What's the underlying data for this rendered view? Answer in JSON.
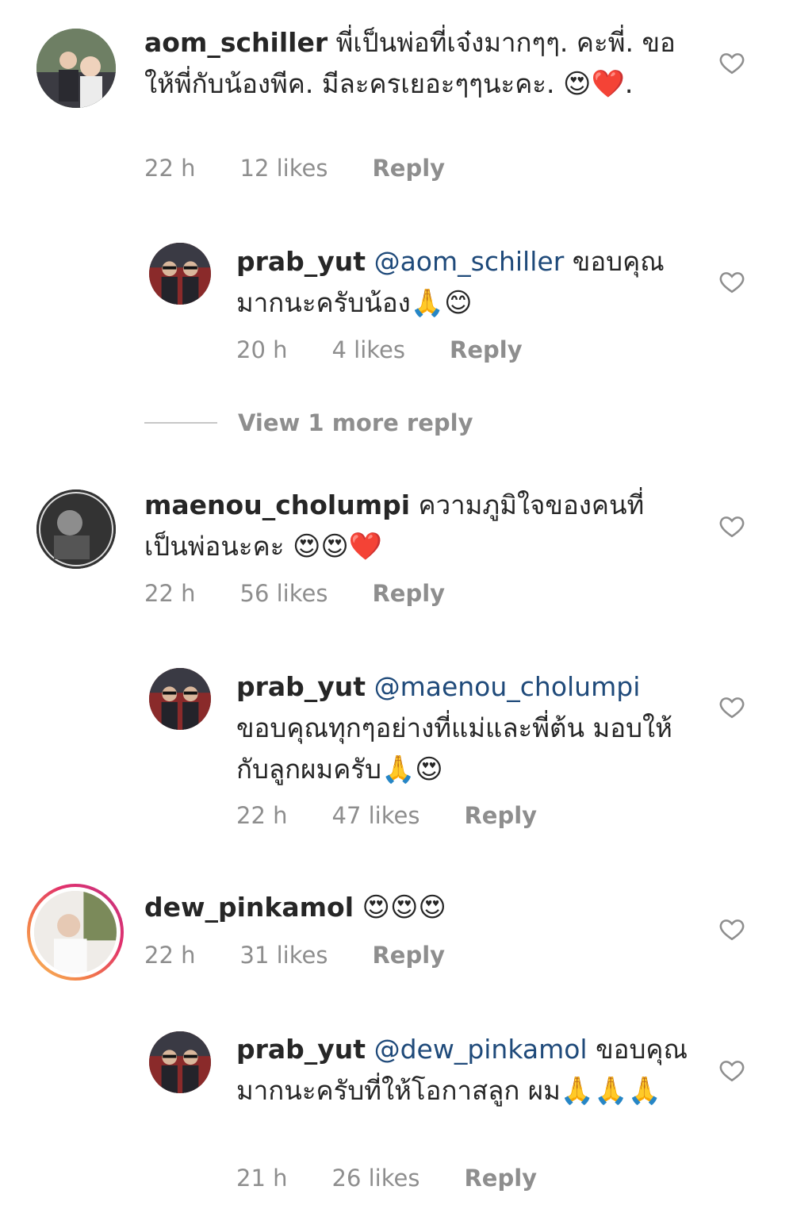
{
  "comments": [
    {
      "username": "aom_schiller",
      "text": "พี่เป็นพ่อที่เจ๋งมากๆๆ.  คะพี่. ขอให้พี่กับน้องพีค.  มีละครเยอะๆๆนะคะ.",
      "emoji": "😍❤️.",
      "time": "22 h",
      "likes": "12 likes",
      "reply": "Reply"
    },
    {
      "username": "prab_yut",
      "mention": "@aom_schiller",
      "text": "ขอบคุณมากนะครับน้อง",
      "emoji": "🙏😊",
      "time": "20 h",
      "likes": "4 likes",
      "reply": "Reply"
    },
    {
      "username": "maenou_cholumpi",
      "text": "ความภูมิใจของคนที่เป็นพ่อนะคะ",
      "emoji": "😍😍❤️",
      "time": "22 h",
      "likes": "56 likes",
      "reply": "Reply"
    },
    {
      "username": "prab_yut",
      "mention": "@maenou_cholumpi",
      "text": "ขอบคุณทุกๆอย่างที่แม่และพี่ต้น มอบให้กับลูกผมครับ",
      "emoji": "🙏😍",
      "time": "22 h",
      "likes": "47 likes",
      "reply": "Reply"
    },
    {
      "username": "dew_pinkamol",
      "text": "",
      "emoji": "😍😍😍",
      "time": "22 h",
      "likes": "31 likes",
      "reply": "Reply"
    },
    {
      "username": "prab_yut",
      "mention": "@dew_pinkamol",
      "text": "ขอบคุณมากนะครับที่ให้โอกาสลูก ผม",
      "emoji": "🙏🙏🙏",
      "time": "21 h",
      "likes": "26 likes",
      "reply": "Reply"
    }
  ],
  "view_more": "View 1 more reply",
  "icons": {
    "like": "heart-outline-icon"
  },
  "colors": {
    "text": "#262626",
    "meta": "#8e8e8e",
    "mention": "#1f4a7a"
  }
}
